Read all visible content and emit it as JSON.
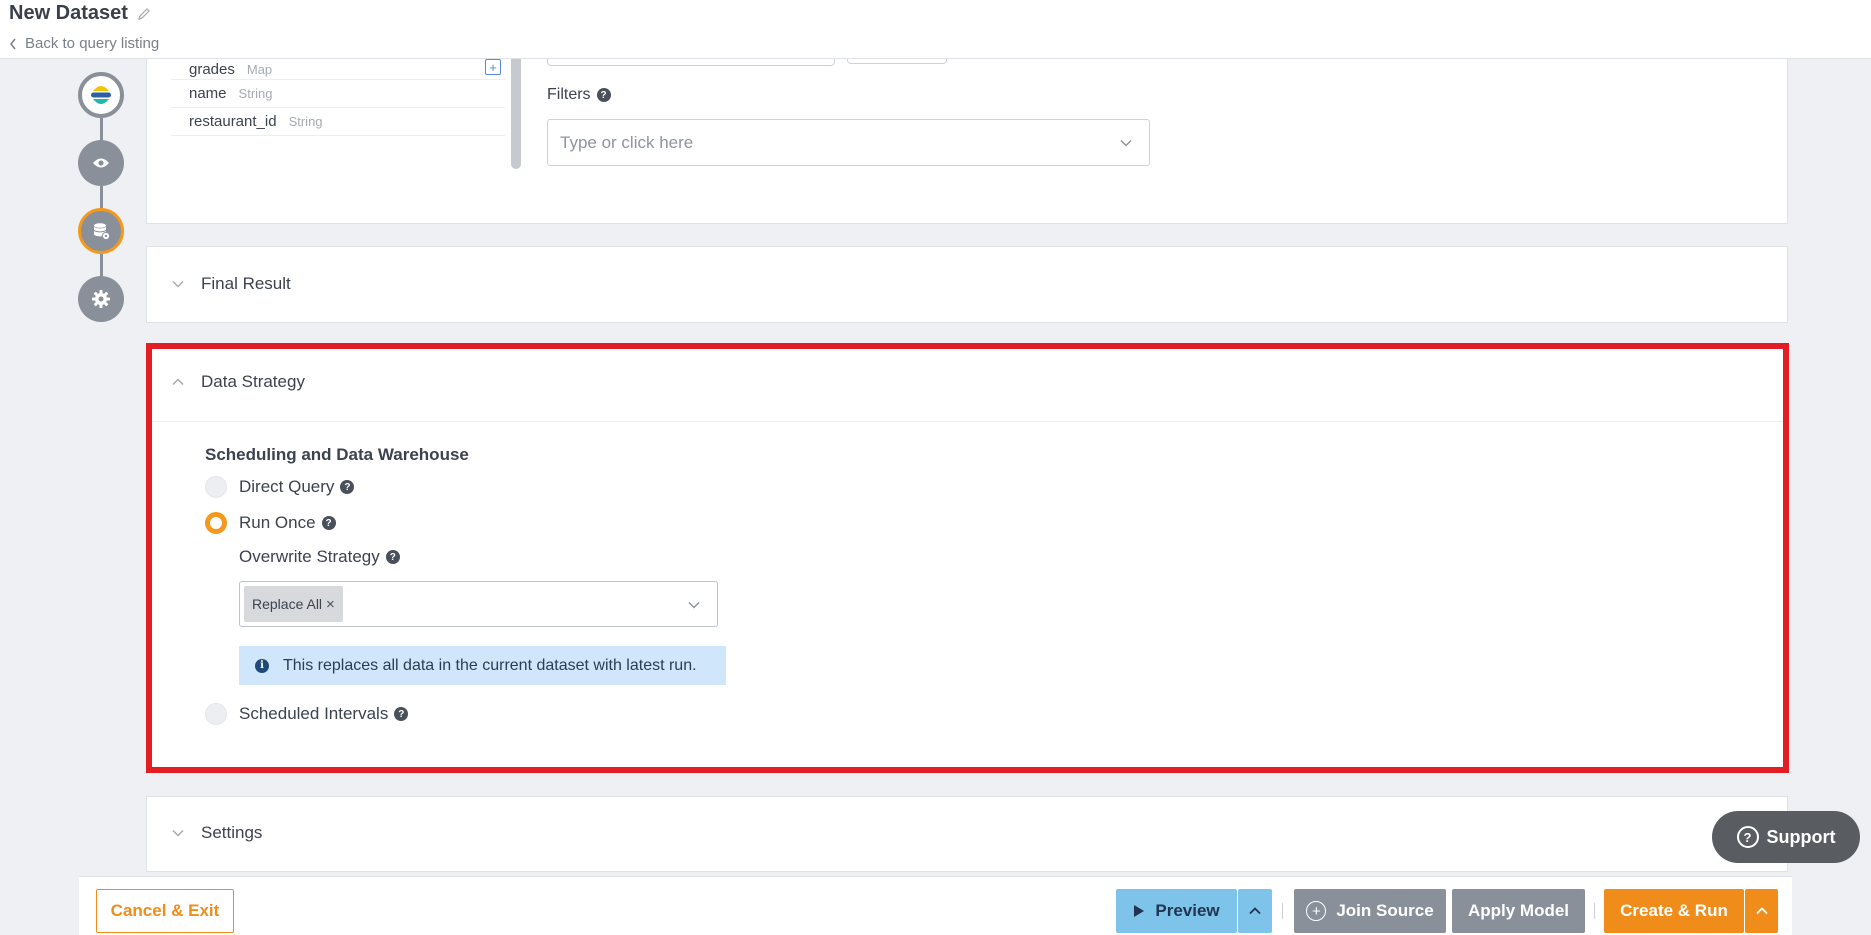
{
  "header": {
    "title": "New Dataset",
    "back_label": "Back to query listing"
  },
  "query_panel": {
    "fields": [
      {
        "name": "grades",
        "type": "Map"
      },
      {
        "name": "name",
        "type": "String"
      },
      {
        "name": "restaurant_id",
        "type": "String"
      }
    ],
    "filters_label": "Filters",
    "filters_placeholder": "Type or click here"
  },
  "final_result": {
    "title": "Final Result"
  },
  "data_strategy": {
    "title": "Data Strategy",
    "section_title": "Scheduling and Data Warehouse",
    "options": [
      {
        "label": "Direct Query",
        "selected": false
      },
      {
        "label": "Run Once",
        "selected": true
      },
      {
        "label": "Scheduled Intervals",
        "selected": false
      }
    ],
    "overwrite_label": "Overwrite Strategy",
    "overwrite_value": "Replace All",
    "info_text": "This replaces all data in the current dataset with latest run."
  },
  "settings": {
    "title": "Settings"
  },
  "support": {
    "label": "Support"
  },
  "footer": {
    "cancel_label": "Cancel & Exit",
    "preview_label": "Preview",
    "join_label": "Join Source",
    "apply_label": "Apply Model",
    "create_label": "Create & Run"
  },
  "colors": {
    "accent": "#f08c1a",
    "highlight": "#e31d24",
    "preview": "#7ec3e9",
    "neutral_button": "#8a9099",
    "info_bg": "#cfe6fb"
  }
}
